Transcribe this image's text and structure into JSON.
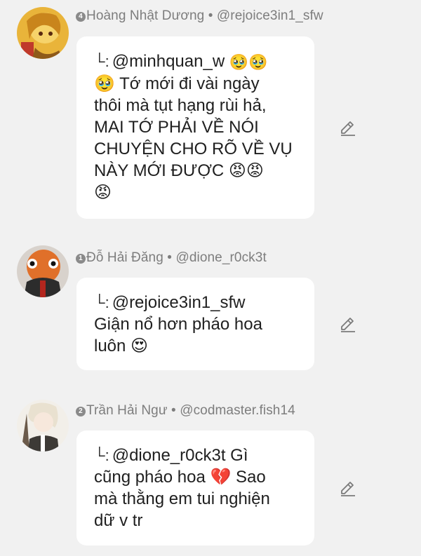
{
  "comments": [
    {
      "rank": "4",
      "author": "Hoàng Nhật Dương",
      "separator": "•",
      "handle": "@rejoice3in1_sfw",
      "reply_to": "@minhquan_w",
      "reply_emoji": "🥹🥹",
      "lines": [
        "🥹 Tớ mới đi vài ngày",
        "thôi mà tụt hạng rùi hả,",
        "MAI TỚ PHẢI VỀ NÓI",
        "CHUYỆN CHO RÕ VỀ VỤ",
        "NÀY MỚI ĐƯỢC 😡😡",
        "😡"
      ]
    },
    {
      "rank": "1",
      "author": "Đỗ Hải Đăng",
      "separator": "•",
      "handle": "@dione_r0ck3t",
      "reply_to": "@rejoice3in1_sfw",
      "reply_emoji": "",
      "lines": [
        "Giận nổ hơn pháo hoa",
        "luôn 😍"
      ]
    },
    {
      "rank": "2",
      "author": "Trần Hải Ngư",
      "separator": "•",
      "handle": "@codmaster.fish14",
      "reply_to": "@dione_r0ck3t",
      "reply_emoji": " Gì",
      "lines": [
        "cũng pháo hoa 💔 Sao",
        "mà thằng em tui nghiện",
        "dữ v tr"
      ]
    }
  ],
  "icons": {
    "reply": "reply-arrow-icon",
    "edit": "pencil-edit-icon"
  },
  "colors": {
    "background": "#f1f1f1",
    "bubble": "#ffffff",
    "meta_text": "#7d7d7d",
    "body_text": "#1f1f1f"
  }
}
